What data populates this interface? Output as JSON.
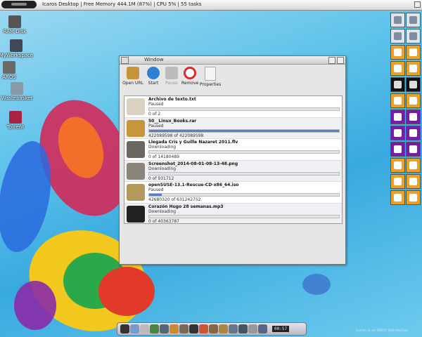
{
  "topbar": {
    "title": "Icaros Desktop | Free Memory 444.1M (87%) | CPU 5% | 55 tasks"
  },
  "desktop_icons": [
    {
      "label": "RAM Disk",
      "color": "#555555",
      "icon": "ram-disk-icon"
    },
    {
      "label": "MyWorkspace",
      "color": "#404858",
      "icon": "workspace-icon"
    },
    {
      "label": "AROS",
      "color": "#6a6a6a",
      "icon": "drive-icon"
    },
    {
      "label": "Wastebasket",
      "color": "#8899aa",
      "icon": "trash-icon"
    },
    {
      "label": "Torrent",
      "color": "#aa2244",
      "icon": "torrent-icon"
    }
  ],
  "window": {
    "title": "Window",
    "toolbar": [
      {
        "label": "Open URL",
        "color": "#c7933a",
        "icon": "open-url-icon"
      },
      {
        "label": "Start",
        "color": "#2e7fd6",
        "icon": "start-icon"
      },
      {
        "label": "Pause",
        "color": "#bbbbbb",
        "icon": "pause-icon"
      },
      {
        "label": "Remove",
        "color": "#d92a2a",
        "icon": "remove-icon"
      },
      {
        "label": "Properties",
        "color": "#f4f4f4",
        "icon": "properties-icon"
      }
    ],
    "downloads": [
      {
        "name": "Archivo de texto.txt",
        "status": "Paused",
        "progress": 0,
        "size": "0 of 2",
        "thumb": "#d9d2c0"
      },
      {
        "name": "50__Linux_Books.rar",
        "status": "Paused",
        "progress": 1,
        "size": "422089598 of 422089598",
        "thumb": "#c7953c"
      },
      {
        "name": "Llegada Cris y Guille Nazaret 2011.flv",
        "status": "Downloading",
        "progress": 0,
        "size": "0 of 14180489",
        "thumb": "#6a6660"
      },
      {
        "name": "Screenshot_2014-08-01-08-13-48.png",
        "status": "Downloading",
        "progress": 0,
        "size": "0 of 931712",
        "thumb": "#8b8478"
      },
      {
        "name": "openSUSE-13.1-Rescue-CD-x86_64.iso",
        "status": "Paused",
        "progress": 0.068,
        "size": "42680320 of 631242752",
        "thumb": "#b39a5c"
      },
      {
        "name": "Corazón Hugo 28 semanas.mp3",
        "status": "Downloading",
        "progress": 0,
        "size": "0 of 40363787",
        "thumb": "#222222"
      }
    ]
  },
  "right_dock": [
    [
      "#dfe3ea",
      "#dfe3ea"
    ],
    [
      "#dfe3ea",
      "#dfe3ea"
    ],
    [
      "#f0a020",
      "#f0a020"
    ],
    [
      "#f0a020",
      "#f0a020"
    ],
    [
      "#111111",
      "#111111"
    ],
    [
      "#f0a020",
      "#f0a020"
    ],
    [
      "#7a1aa8",
      "#7a1aa8"
    ],
    [
      "#7a1aa8",
      "#7a1aa8"
    ],
    [
      "#7a1aa8",
      "#7a1aa8"
    ],
    [
      "#f0a020",
      "#f0a020"
    ],
    [
      "#f0a020",
      "#f0a020"
    ],
    [
      "#f0a020",
      "#f0a020"
    ]
  ],
  "bottom_dock": {
    "items": [
      "#333333",
      "#7799cc",
      "#bbbbbb",
      "#448844",
      "#556677",
      "#cc8833",
      "#7a6a55",
      "#333333",
      "#cc5533",
      "#886644",
      "#aa8844",
      "#667788",
      "#445566",
      "#999999",
      "#556688"
    ],
    "clock": "00:57"
  },
  "watermark": "Icaros is an AROS distribution"
}
